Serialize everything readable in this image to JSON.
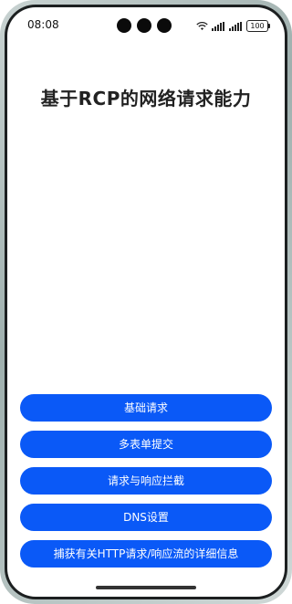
{
  "status_bar": {
    "time": "08:08",
    "battery": "100"
  },
  "page": {
    "title": "基于RCP的网络请求能力"
  },
  "buttons": [
    {
      "label": "基础请求"
    },
    {
      "label": "多表单提交"
    },
    {
      "label": "请求与响应拦截"
    },
    {
      "label": "DNS设置"
    },
    {
      "label": "捕获有关HTTP请求/响应流的详细信息"
    }
  ],
  "colors": {
    "accent": "#0a59f7",
    "title": "#222222",
    "background": "#ffffff"
  },
  "icons": [
    "wifi-icon",
    "signal-icon",
    "battery-icon"
  ]
}
